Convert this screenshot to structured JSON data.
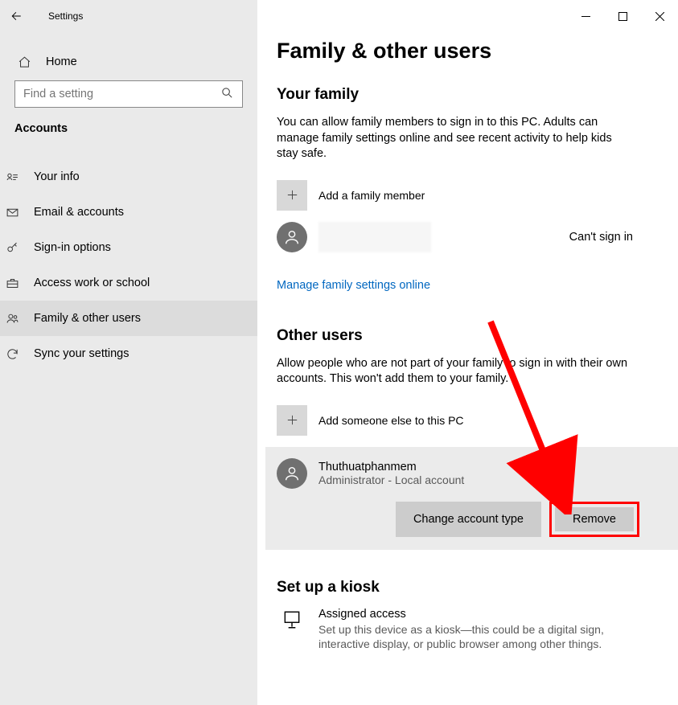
{
  "window": {
    "app_title": "Settings",
    "minimize": "–",
    "maximize": "☐",
    "close": "✕"
  },
  "sidebar": {
    "home_label": "Home",
    "search_placeholder": "Find a setting",
    "section": "Accounts",
    "items": [
      {
        "label": "Your info"
      },
      {
        "label": "Email & accounts"
      },
      {
        "label": "Sign-in options"
      },
      {
        "label": "Access work or school"
      },
      {
        "label": "Family & other users"
      },
      {
        "label": "Sync your settings"
      }
    ]
  },
  "main": {
    "title": "Family & other users",
    "family": {
      "heading": "Your family",
      "desc": "You can allow family members to sign in to this PC. Adults can manage family settings online and see recent activity to help kids stay safe.",
      "add_label": "Add a family member",
      "member_status": "Can't sign in",
      "manage_link": "Manage family settings online"
    },
    "other": {
      "heading": "Other users",
      "desc": "Allow people who are not part of your family to sign in with their own accounts. This won't add them to your family.",
      "add_label": "Add someone else to this PC",
      "user_name": "Thuthuatphanmem",
      "user_role": "Administrator - Local account",
      "change_btn": "Change account type",
      "remove_btn": "Remove"
    },
    "kiosk": {
      "heading": "Set up a kiosk",
      "title": "Assigned access",
      "desc": "Set up this device as a kiosk—this could be a digital sign, interactive display, or public browser among other things."
    }
  }
}
